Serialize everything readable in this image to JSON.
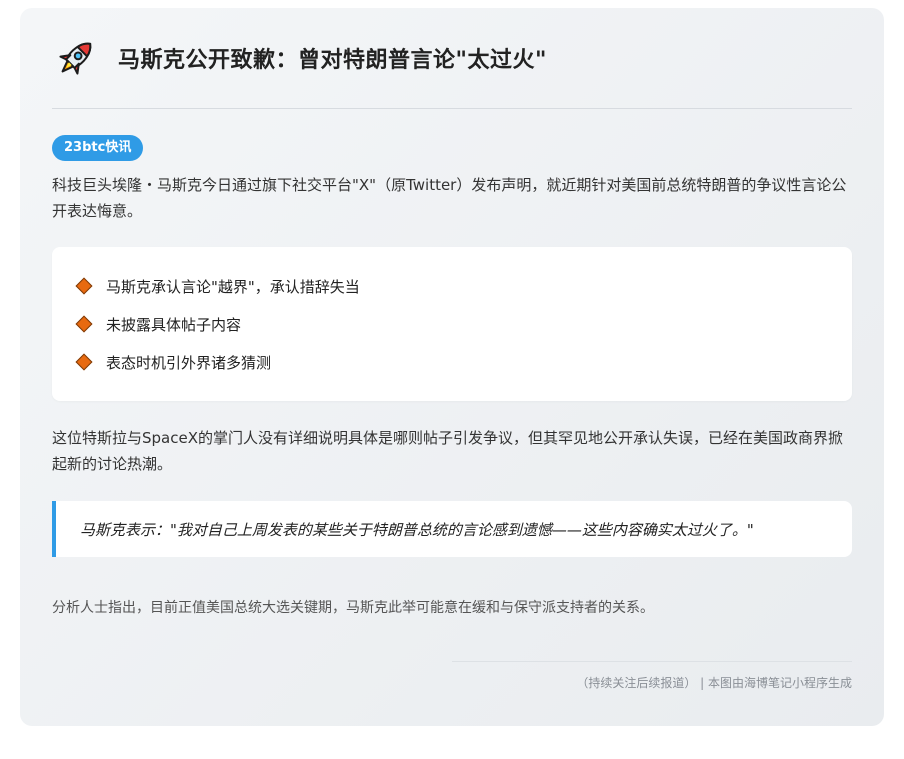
{
  "header": {
    "icon": "rocket-icon",
    "title": "马斯克公开致歉：曾对特朗普言论\"太过火\""
  },
  "badge": "23btc快讯",
  "lead": "科技巨头埃隆・马斯克今日通过旗下社交平台\"X\"（原Twitter）发布声明，就近期针对美国前总统特朗普的争议性言论公开表达悔意。",
  "points": [
    "马斯克承认言论\"越界\"，承认措辞失当",
    "未披露具体帖子内容",
    "表态时机引外界诸多猜测"
  ],
  "paragraph2": "这位特斯拉与SpaceX的掌门人没有详细说明具体是哪则帖子引发争议，但其罕见地公开承认失误，已经在美国政商界掀起新的讨论热潮。",
  "quote": "马斯克表示：\"我对自己上周发表的某些关于特朗普总统的言论感到遗憾——这些内容确实太过火了。\"",
  "paragraph3": "分析人士指出，目前正值美国总统大选关键期，马斯克此举可能意在缓和与保守派支持者的关系。",
  "footer": "（持续关注后续报道） | 本图由海博笔记小程序生成",
  "colors": {
    "accent": "#2f9be6",
    "bullet": "#e86a10"
  }
}
